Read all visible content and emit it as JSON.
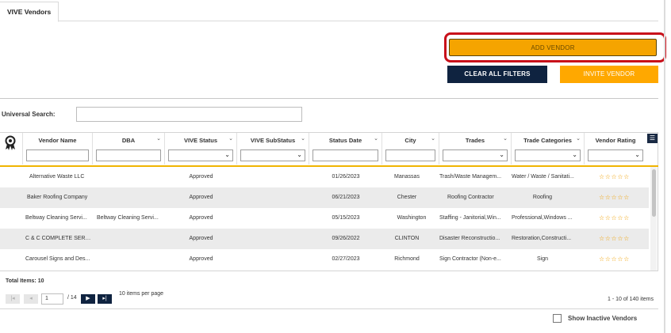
{
  "tabs": [
    {
      "label": "VIVE Vendors",
      "active": true
    }
  ],
  "buttons": {
    "add_vendor": "ADD VENDOR",
    "clear_filters": "CLEAR ALL FILTERS",
    "invite_vendor": "INVITE VENDOR"
  },
  "search": {
    "label": "Universal Search:",
    "value": ""
  },
  "colors": {
    "accent_orange": "#F5A400",
    "navy": "#0F2340",
    "highlight_ring": "#C8101A",
    "star": "#F0A000"
  },
  "grid": {
    "columns": [
      {
        "key": "vendor_name",
        "label": "Vendor Name",
        "filter": "text"
      },
      {
        "key": "dba",
        "label": "DBA",
        "filter": "text"
      },
      {
        "key": "vive_status",
        "label": "VIVE Status",
        "filter": "select"
      },
      {
        "key": "vive_substatus",
        "label": "VIVE SubStatus",
        "filter": "select"
      },
      {
        "key": "status_date",
        "label": "Status Date",
        "filter": "text"
      },
      {
        "key": "city",
        "label": "City",
        "filter": "text"
      },
      {
        "key": "trades",
        "label": "Trades",
        "filter": "select"
      },
      {
        "key": "trade_categories",
        "label": "Trade Categories",
        "filter": "select"
      },
      {
        "key": "vendor_rating",
        "label": "Vendor Rating",
        "filter": "select"
      }
    ],
    "rows": [
      {
        "vendor_name": "Alternative Waste LLC",
        "dba": "",
        "vive_status": "Approved",
        "vive_substatus": "",
        "status_date": "01/26/2023",
        "city": "Manassas",
        "trades": "Trash/Waste Managem...",
        "trade_categories": "Water / Waste / Sanitati...",
        "vendor_rating": "☆☆☆☆☆"
      },
      {
        "vendor_name": "Baker Roofing Company",
        "dba": "",
        "vive_status": "Approved",
        "vive_substatus": "",
        "status_date": "06/21/2023",
        "city": "Chester",
        "trades": "Roofing Contractor",
        "trade_categories": "Roofing",
        "vendor_rating": "☆☆☆☆☆"
      },
      {
        "vendor_name": "Beltway Cleaning Servi...",
        "dba": "Beltway Cleaning Servi...",
        "vive_status": "Approved",
        "vive_substatus": "",
        "status_date": "05/15/2023",
        "city": "Washington",
        "trades": "Staffing - Janitorial,Win...",
        "trade_categories": "Professional,Windows ...",
        "vendor_rating": "☆☆☆☆☆"
      },
      {
        "vendor_name": "C & C COMPLETE SERVI...",
        "dba": "",
        "vive_status": "Approved",
        "vive_substatus": "",
        "status_date": "09/26/2022",
        "city": "CLINTON",
        "trades": "Disaster Reconstructio...",
        "trade_categories": "Restoration,Constructi...",
        "vendor_rating": "☆☆☆☆☆"
      },
      {
        "vendor_name": "Carousel Signs and Des...",
        "dba": "",
        "vive_status": "Approved",
        "vive_substatus": "",
        "status_date": "02/27/2023",
        "city": "Richmond",
        "trades": "Sign Contractor (Non-e...",
        "trade_categories": "Sign",
        "vendor_rating": "☆☆☆☆☆"
      }
    ]
  },
  "footer": {
    "total_items": "Total Items: 10",
    "page_value": "1",
    "of_pages": "/ 14",
    "per_page": "10 items per page",
    "range": "1 - 10 of 140 items"
  },
  "show_inactive": {
    "label": "Show Inactive Vendors",
    "checked": false
  }
}
